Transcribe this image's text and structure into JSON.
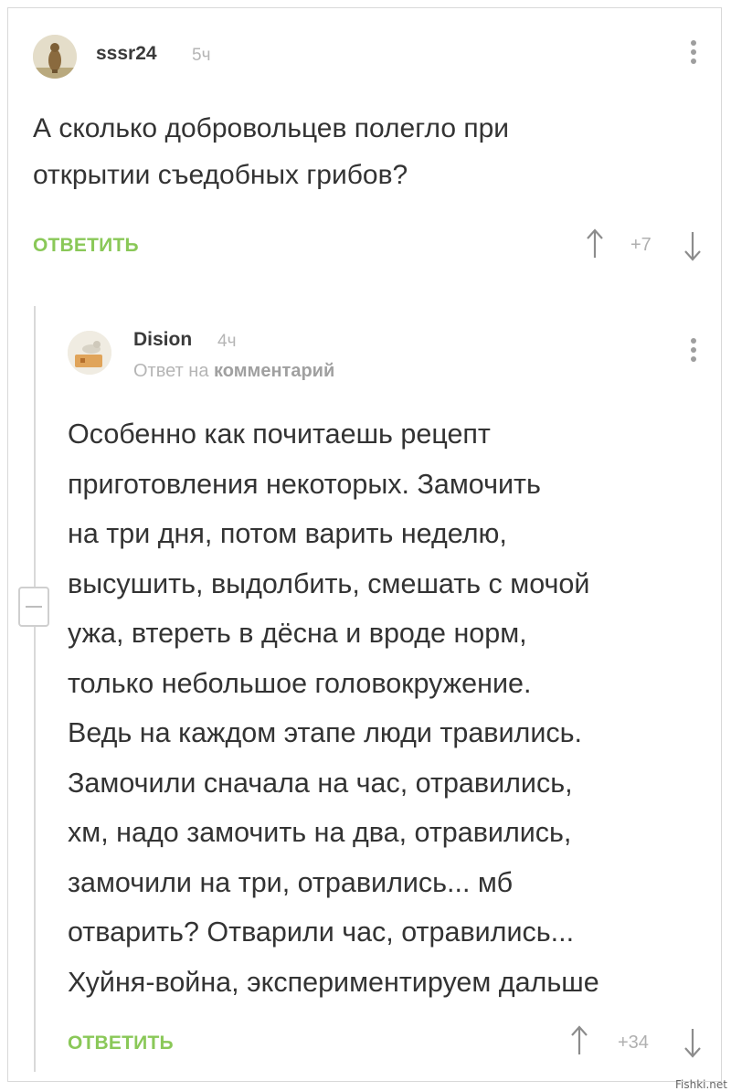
{
  "comment": {
    "username": "sssr24",
    "time": "5ч",
    "text_lines": [
      "А сколько добровольцев полегло при",
      "открытии съедобных грибов?"
    ],
    "reply_label": "ОТВЕТИТЬ",
    "rating": "+7"
  },
  "reply": {
    "username": "Dision",
    "time": "4ч",
    "reply_to_prefix": "Ответ на",
    "reply_to_link": "комментарий",
    "text_lines": [
      "Особенно как почитаешь рецепт",
      "приготовления некоторых. Замочить",
      "на три дня, потом варить неделю,",
      "высушить, выдолбить, смешать с мочой",
      "ужа, втереть в дёсна и вроде норм,",
      "только небольшое головокружение.",
      "Ведь на каждом этапе люди травились.",
      "Замочили сначала на час, отравились,",
      "хм, надо замочить на два, отравились,",
      "замочили на три, отравились... мб",
      "отварить? Отварили час, отравились...",
      "Хуйня-война, экспериментируем дальше"
    ],
    "reply_label": "ОТВЕТИТЬ",
    "rating": "+34"
  },
  "watermark": "Fishki.net",
  "colors": {
    "accent_green": "#8ac858",
    "muted_gray": "#b5b5b5",
    "text": "#333333"
  },
  "icons": {
    "menu": "vertical-dots-icon",
    "upvote": "arrow-up-icon",
    "downvote": "arrow-down-icon",
    "collapse": "collapse-minus-icon"
  }
}
